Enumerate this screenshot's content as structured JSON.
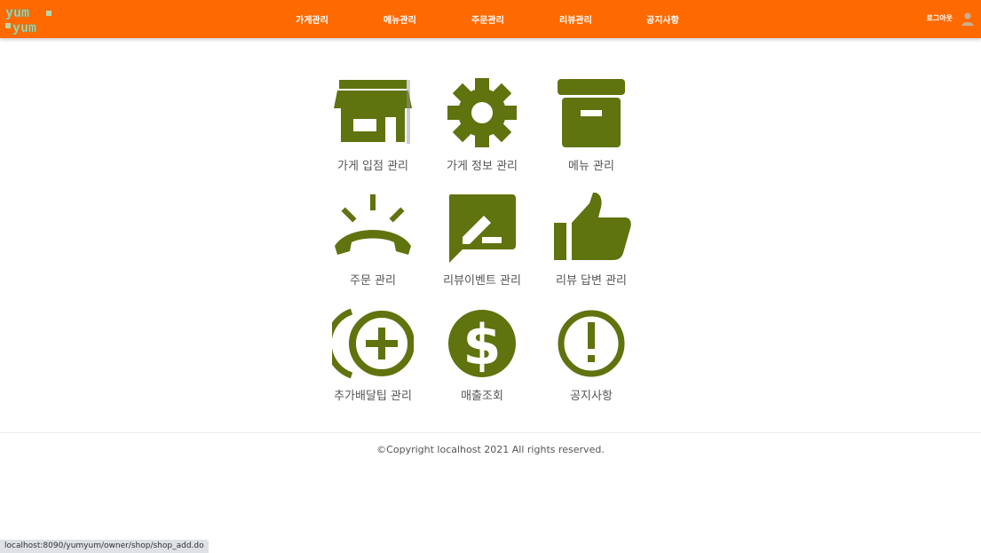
{
  "header": {
    "logo_text": "yum yum",
    "nav": [
      "가게관리",
      "메뉴관리",
      "주문관리",
      "리뷰관리",
      "공지사항"
    ],
    "logout_label": "로그아웃",
    "accent_color": "#ff6a00"
  },
  "tiles": [
    {
      "icon": "store-icon",
      "label": "가게 입점 관리"
    },
    {
      "icon": "gear-icon",
      "label": "가게 정보 관리"
    },
    {
      "icon": "archive-box-icon",
      "label": "메뉴 관리"
    },
    {
      "icon": "ringing-phone-icon",
      "label": "주문 관리"
    },
    {
      "icon": "edit-comment-icon",
      "label": "리뷰이벤트 관리"
    },
    {
      "icon": "thumbs-up-icon",
      "label": "리뷰 답변 관리"
    },
    {
      "icon": "add-circle-icon",
      "label": "추가배달팁 관리"
    },
    {
      "icon": "dollar-circle-icon",
      "label": "매출조회"
    },
    {
      "icon": "exclamation-circle-icon",
      "label": "공지사항"
    }
  ],
  "icon_color": "#5f730e",
  "footer": {
    "copyright": "©Copyright localhost 2021 All rights reserved."
  },
  "status_bar": {
    "url": "localhost:8090/yumyum/owner/shop/shop_add.do"
  }
}
